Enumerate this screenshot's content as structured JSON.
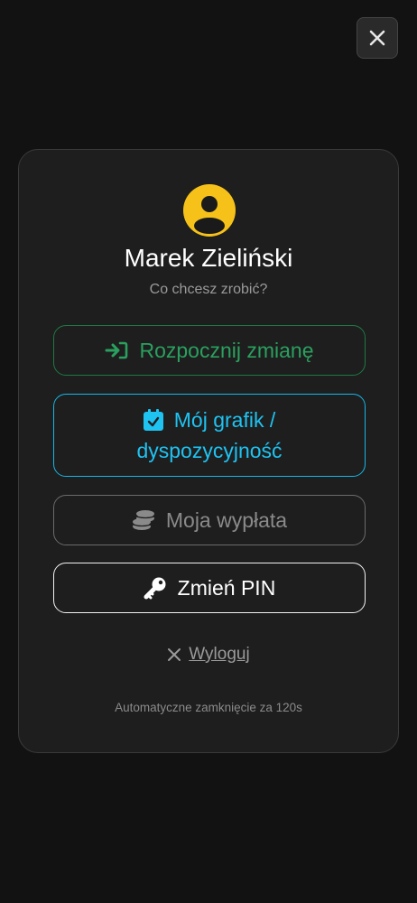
{
  "close": {
    "icon": "close-icon"
  },
  "profile": {
    "avatar_icon": "user-icon",
    "name": "Marek Zieliński",
    "subtitle": "Co chcesz zrobić?"
  },
  "actions": {
    "start_shift": {
      "label": "Rozpocznij zmianę",
      "icon": "sign-in-icon",
      "color": "#2aa05f"
    },
    "schedule": {
      "line1": "Mój grafik /",
      "line2": "dyspozycyjność",
      "icon": "calendar-check-icon",
      "color": "#1ec3f2"
    },
    "payout": {
      "label": "Moja wypłata",
      "icon": "coins-icon",
      "color": "#8a8a8a"
    },
    "change_pin": {
      "label": "Zmień PIN",
      "icon": "key-icon",
      "color": "#ffffff"
    }
  },
  "logout": {
    "label": "Wyloguj",
    "icon": "close-icon"
  },
  "auto_close_text": "Automatyczne zamknięcie za 120s"
}
